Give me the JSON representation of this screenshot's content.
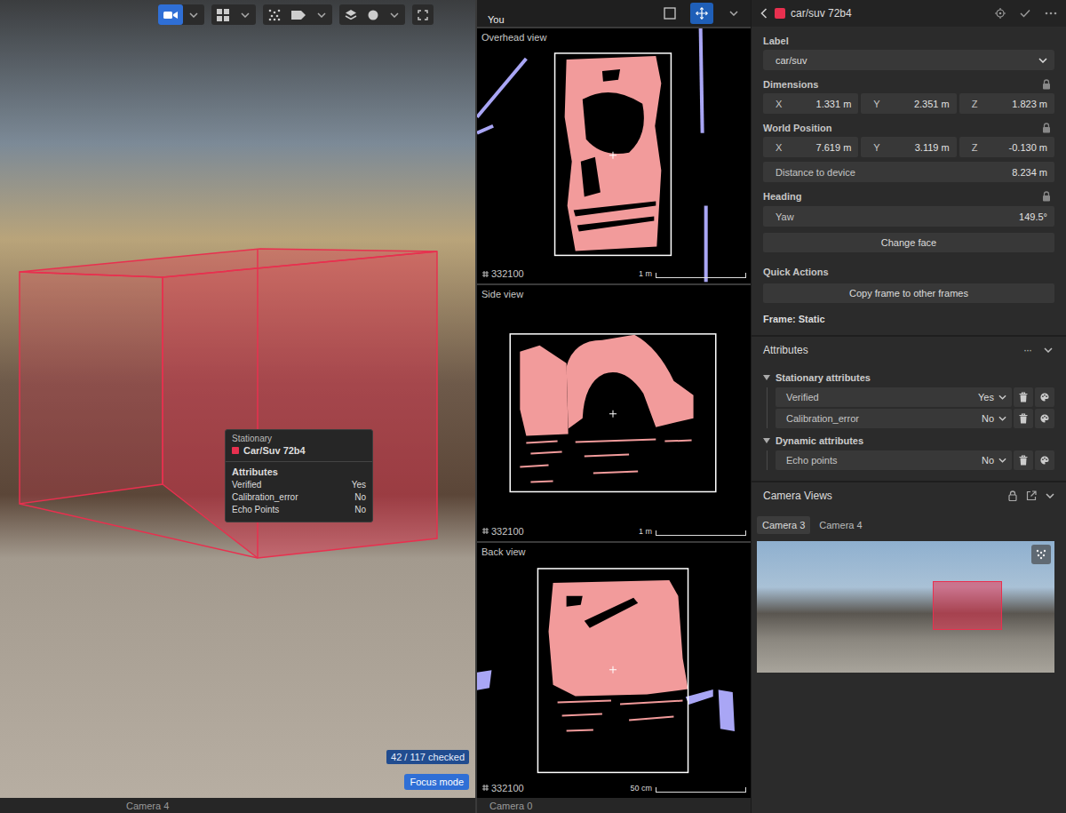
{
  "camera_view": {
    "annotation_color": "#e8304f",
    "tooltip": {
      "state": "Stationary",
      "label": "Car/Suv 72b4",
      "color": "#e8304f",
      "section": "Attributes",
      "rows": [
        {
          "name": "Verified",
          "value": "Yes"
        },
        {
          "name": "Calibration_error",
          "value": "No"
        },
        {
          "name": "Echo Points",
          "value": "No"
        }
      ]
    },
    "checked_badge": "42 / 117 checked",
    "focus_button": "Focus mode"
  },
  "bottom_strip": [
    {
      "label": "Camera 4"
    },
    {
      "label": "Camera 0"
    }
  ],
  "views_panel": {
    "user": "You",
    "views": [
      {
        "title": "Overhead view",
        "frame": "332100",
        "scale": "1 m"
      },
      {
        "title": "Side view",
        "frame": "332100",
        "scale": "1 m"
      },
      {
        "title": "Back view",
        "frame": "332100",
        "scale": "50 cm"
      }
    ]
  },
  "inspector": {
    "title": "car/suv 72b4",
    "color": "#e8304f",
    "label": {
      "heading": "Label",
      "value": "car/suv"
    },
    "dimensions": {
      "heading": "Dimensions",
      "locked": true,
      "fields": [
        {
          "axis": "X",
          "value": "1.331 m"
        },
        {
          "axis": "Y",
          "value": "2.351 m"
        },
        {
          "axis": "Z",
          "value": "1.823 m"
        }
      ]
    },
    "world_position": {
      "heading": "World Position",
      "locked": true,
      "fields": [
        {
          "axis": "X",
          "value": "7.619 m"
        },
        {
          "axis": "Y",
          "value": "3.119 m"
        },
        {
          "axis": "Z",
          "value": "-0.130 m"
        }
      ],
      "distance": {
        "label": "Distance to device",
        "value": "8.234 m"
      }
    },
    "heading": {
      "heading": "Heading",
      "locked": true,
      "field": {
        "label": "Yaw",
        "value": "149.5°"
      }
    },
    "change_face": "Change face",
    "quick_actions": {
      "heading": "Quick Actions",
      "button": "Copy frame to other frames"
    },
    "frame": "Frame: Static",
    "attributes": {
      "heading": "Attributes",
      "more": "···",
      "groups": [
        {
          "title": "Stationary attributes",
          "expanded": true,
          "rows": [
            {
              "name": "Verified",
              "value": "Yes"
            },
            {
              "name": "Calibration_error",
              "value": "No"
            }
          ]
        },
        {
          "title": "Dynamic attributes",
          "expanded": true,
          "rows": [
            {
              "name": "Echo points",
              "value": "No"
            }
          ]
        }
      ]
    },
    "camera_views": {
      "heading": "Camera Views",
      "locked": true,
      "tabs": [
        {
          "label": "Camera 3",
          "selected": true
        },
        {
          "label": "Camera 4",
          "selected": false
        }
      ]
    }
  }
}
